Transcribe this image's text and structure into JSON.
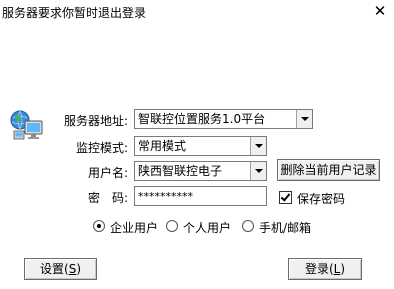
{
  "window": {
    "title": "服务器要求你暂时退出登录",
    "close_glyph": "✕"
  },
  "form": {
    "server_label": "服务器地址:",
    "server_value": "智联控位置服务1.0平台",
    "mode_label": "监控模式:",
    "mode_value": "常用模式",
    "user_label": "用户名:",
    "user_value": "陕西智联控电子",
    "delete_user_button": "删除当前用户记录",
    "password_label": "密　码:",
    "password_value": "**********",
    "save_password_label": "保存密码",
    "save_password_checked": true
  },
  "user_types": {
    "options": [
      "企业用户",
      "个人用户",
      "手机/邮箱"
    ],
    "selected_index": 0
  },
  "buttons": {
    "settings_text": "设置(",
    "settings_key": "S",
    "settings_close": ")",
    "login_text": "登录(",
    "login_key": "L",
    "login_close": ")"
  },
  "icons": {
    "network": "network-computers-icon"
  }
}
